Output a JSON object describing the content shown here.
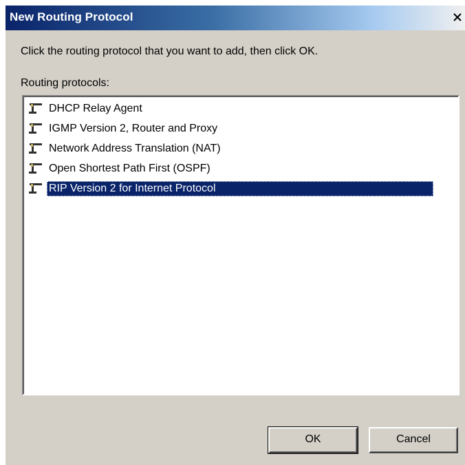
{
  "window": {
    "title": "New Routing Protocol",
    "close_label": "✕"
  },
  "dialog": {
    "instruction": "Click the routing protocol that you want to add, then click OK.",
    "list_label": "Routing protocols:",
    "protocols": [
      {
        "label": "DHCP Relay Agent",
        "icon": "router-icon",
        "selected": false
      },
      {
        "label": "IGMP Version 2, Router and Proxy",
        "icon": "router-icon",
        "selected": false
      },
      {
        "label": "Network Address Translation (NAT)",
        "icon": "router-icon",
        "selected": false
      },
      {
        "label": "Open Shortest Path First (OSPF)",
        "icon": "router-icon",
        "selected": false
      },
      {
        "label": "RIP Version 2 for Internet Protocol",
        "icon": "router-icon",
        "selected": true
      }
    ],
    "selected_color": "#0a246a"
  },
  "buttons": {
    "ok_label": "OK",
    "cancel_label": "Cancel"
  }
}
